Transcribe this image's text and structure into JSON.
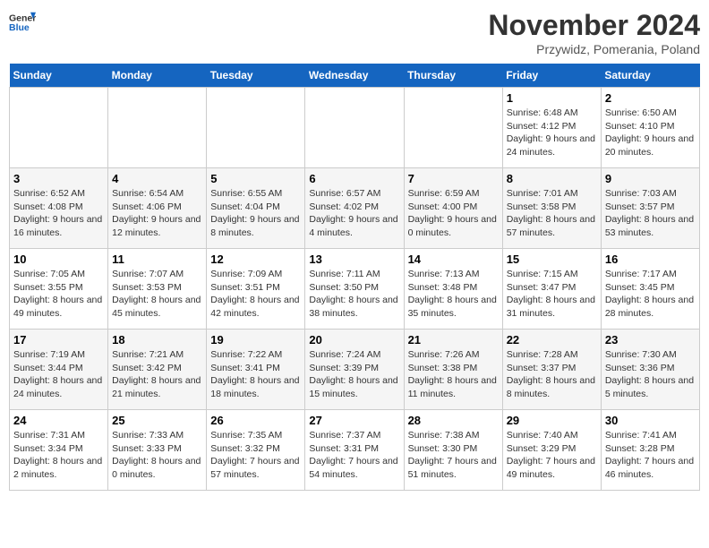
{
  "logo": {
    "general": "General",
    "blue": "Blue"
  },
  "title": "November 2024",
  "subtitle": "Przywidz, Pomerania, Poland",
  "days_of_week": [
    "Sunday",
    "Monday",
    "Tuesday",
    "Wednesday",
    "Thursday",
    "Friday",
    "Saturday"
  ],
  "weeks": [
    [
      {
        "day": "",
        "info": ""
      },
      {
        "day": "",
        "info": ""
      },
      {
        "day": "",
        "info": ""
      },
      {
        "day": "",
        "info": ""
      },
      {
        "day": "",
        "info": ""
      },
      {
        "day": "1",
        "info": "Sunrise: 6:48 AM\nSunset: 4:12 PM\nDaylight: 9 hours and 24 minutes."
      },
      {
        "day": "2",
        "info": "Sunrise: 6:50 AM\nSunset: 4:10 PM\nDaylight: 9 hours and 20 minutes."
      }
    ],
    [
      {
        "day": "3",
        "info": "Sunrise: 6:52 AM\nSunset: 4:08 PM\nDaylight: 9 hours and 16 minutes."
      },
      {
        "day": "4",
        "info": "Sunrise: 6:54 AM\nSunset: 4:06 PM\nDaylight: 9 hours and 12 minutes."
      },
      {
        "day": "5",
        "info": "Sunrise: 6:55 AM\nSunset: 4:04 PM\nDaylight: 9 hours and 8 minutes."
      },
      {
        "day": "6",
        "info": "Sunrise: 6:57 AM\nSunset: 4:02 PM\nDaylight: 9 hours and 4 minutes."
      },
      {
        "day": "7",
        "info": "Sunrise: 6:59 AM\nSunset: 4:00 PM\nDaylight: 9 hours and 0 minutes."
      },
      {
        "day": "8",
        "info": "Sunrise: 7:01 AM\nSunset: 3:58 PM\nDaylight: 8 hours and 57 minutes."
      },
      {
        "day": "9",
        "info": "Sunrise: 7:03 AM\nSunset: 3:57 PM\nDaylight: 8 hours and 53 minutes."
      }
    ],
    [
      {
        "day": "10",
        "info": "Sunrise: 7:05 AM\nSunset: 3:55 PM\nDaylight: 8 hours and 49 minutes."
      },
      {
        "day": "11",
        "info": "Sunrise: 7:07 AM\nSunset: 3:53 PM\nDaylight: 8 hours and 45 minutes."
      },
      {
        "day": "12",
        "info": "Sunrise: 7:09 AM\nSunset: 3:51 PM\nDaylight: 8 hours and 42 minutes."
      },
      {
        "day": "13",
        "info": "Sunrise: 7:11 AM\nSunset: 3:50 PM\nDaylight: 8 hours and 38 minutes."
      },
      {
        "day": "14",
        "info": "Sunrise: 7:13 AM\nSunset: 3:48 PM\nDaylight: 8 hours and 35 minutes."
      },
      {
        "day": "15",
        "info": "Sunrise: 7:15 AM\nSunset: 3:47 PM\nDaylight: 8 hours and 31 minutes."
      },
      {
        "day": "16",
        "info": "Sunrise: 7:17 AM\nSunset: 3:45 PM\nDaylight: 8 hours and 28 minutes."
      }
    ],
    [
      {
        "day": "17",
        "info": "Sunrise: 7:19 AM\nSunset: 3:44 PM\nDaylight: 8 hours and 24 minutes."
      },
      {
        "day": "18",
        "info": "Sunrise: 7:21 AM\nSunset: 3:42 PM\nDaylight: 8 hours and 21 minutes."
      },
      {
        "day": "19",
        "info": "Sunrise: 7:22 AM\nSunset: 3:41 PM\nDaylight: 8 hours and 18 minutes."
      },
      {
        "day": "20",
        "info": "Sunrise: 7:24 AM\nSunset: 3:39 PM\nDaylight: 8 hours and 15 minutes."
      },
      {
        "day": "21",
        "info": "Sunrise: 7:26 AM\nSunset: 3:38 PM\nDaylight: 8 hours and 11 minutes."
      },
      {
        "day": "22",
        "info": "Sunrise: 7:28 AM\nSunset: 3:37 PM\nDaylight: 8 hours and 8 minutes."
      },
      {
        "day": "23",
        "info": "Sunrise: 7:30 AM\nSunset: 3:36 PM\nDaylight: 8 hours and 5 minutes."
      }
    ],
    [
      {
        "day": "24",
        "info": "Sunrise: 7:31 AM\nSunset: 3:34 PM\nDaylight: 8 hours and 2 minutes."
      },
      {
        "day": "25",
        "info": "Sunrise: 7:33 AM\nSunset: 3:33 PM\nDaylight: 8 hours and 0 minutes."
      },
      {
        "day": "26",
        "info": "Sunrise: 7:35 AM\nSunset: 3:32 PM\nDaylight: 7 hours and 57 minutes."
      },
      {
        "day": "27",
        "info": "Sunrise: 7:37 AM\nSunset: 3:31 PM\nDaylight: 7 hours and 54 minutes."
      },
      {
        "day": "28",
        "info": "Sunrise: 7:38 AM\nSunset: 3:30 PM\nDaylight: 7 hours and 51 minutes."
      },
      {
        "day": "29",
        "info": "Sunrise: 7:40 AM\nSunset: 3:29 PM\nDaylight: 7 hours and 49 minutes."
      },
      {
        "day": "30",
        "info": "Sunrise: 7:41 AM\nSunset: 3:28 PM\nDaylight: 7 hours and 46 minutes."
      }
    ]
  ]
}
